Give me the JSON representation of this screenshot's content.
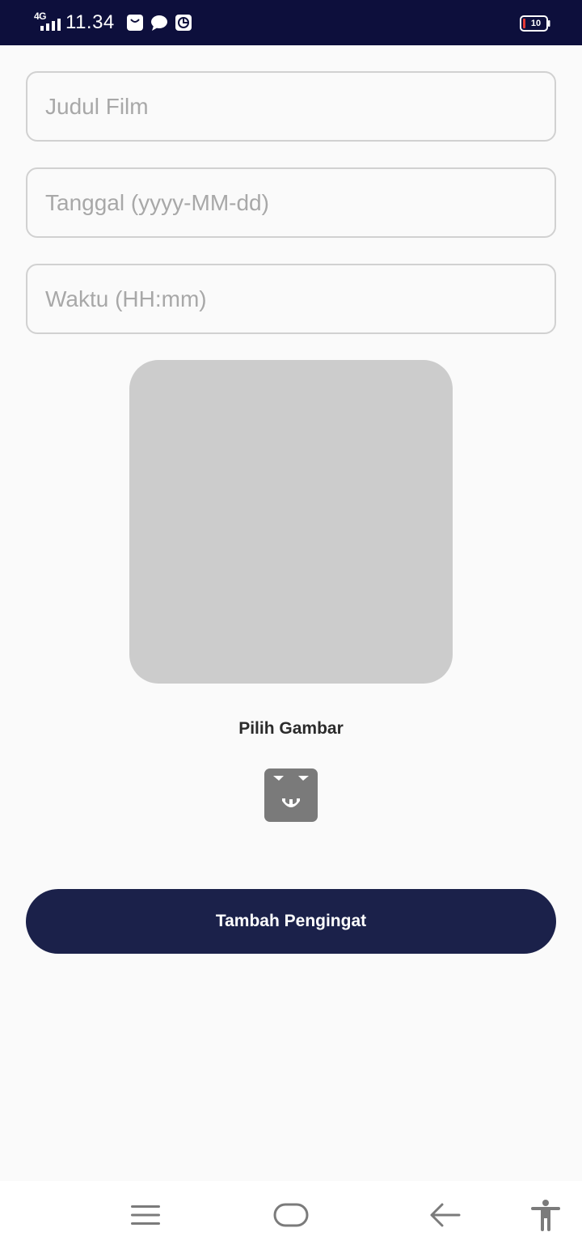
{
  "status_bar": {
    "network": "4G",
    "time": "11.34",
    "battery_level": "10",
    "icons": [
      "bag-icon",
      "chat-bubble-icon",
      "pie-chart-icon"
    ]
  },
  "form": {
    "title_placeholder": "Judul Film",
    "title_value": "",
    "date_placeholder": "Tanggal (yyyy-MM-dd)",
    "date_value": "",
    "time_placeholder": "Waktu (HH:mm)",
    "time_value": "",
    "pick_image_label": "Pilih Gambar",
    "pick_image_icon": "image-picker-icon",
    "submit_label": "Tambah Pengingat"
  },
  "nav_bar": {
    "icons": [
      "menu-icon",
      "home-icon",
      "back-icon",
      "accessibility-icon"
    ]
  },
  "colors": {
    "status_bar": "#0d0f3c",
    "background": "#fafafa",
    "field_border": "#d1d1d1",
    "placeholder": "#a8a8a8",
    "image_preview": "#cccccc",
    "pick_button": "#7a7a7a",
    "primary": "#1b214a",
    "battery_low": "#e53935"
  }
}
